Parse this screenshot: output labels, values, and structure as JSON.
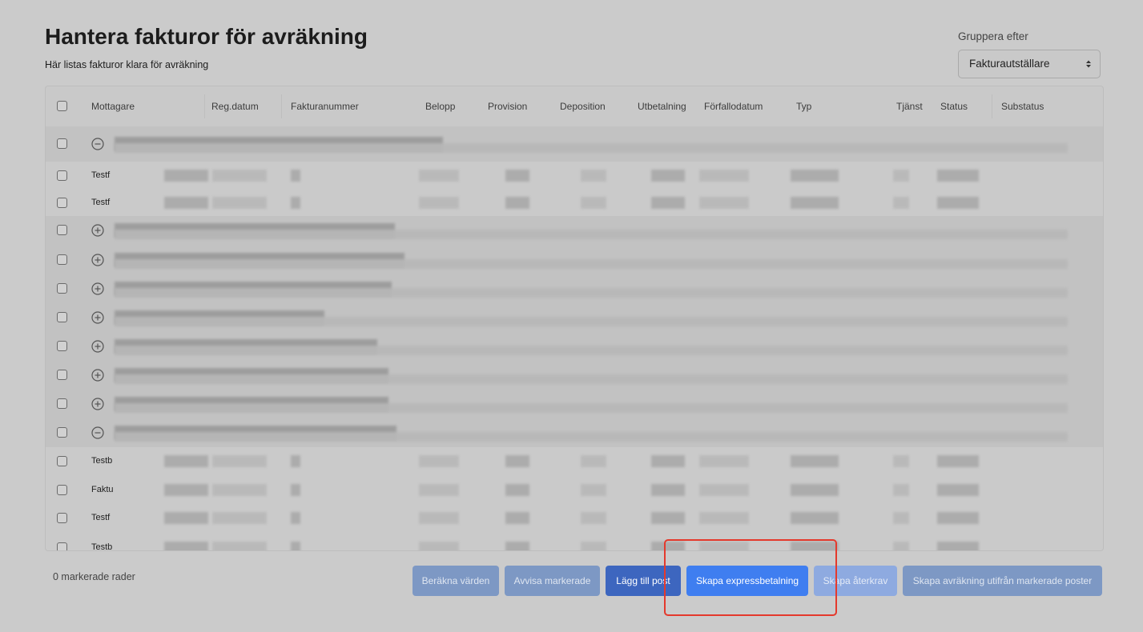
{
  "page": {
    "title": "Hantera fakturor för avräkning",
    "subtitle": "Här listas fakturor klara för avräkning"
  },
  "group_by": {
    "label": "Gruppera efter",
    "value": "Fakturautställare"
  },
  "table": {
    "columns": [
      "Mottagare",
      "Reg.datum",
      "Fakturanummer",
      "Belopp",
      "Provision",
      "Deposition",
      "Utbetalning",
      "Förfallodatum",
      "Typ",
      "Tjänst",
      "Status",
      "Substatus"
    ],
    "rows": [
      {
        "kind": "group",
        "state": "expanded"
      },
      {
        "kind": "item",
        "mottagare": "Testf"
      },
      {
        "kind": "item",
        "mottagare": "Testf"
      },
      {
        "kind": "group",
        "state": "collapsed"
      },
      {
        "kind": "group",
        "state": "collapsed"
      },
      {
        "kind": "group",
        "state": "collapsed"
      },
      {
        "kind": "group",
        "state": "collapsed"
      },
      {
        "kind": "group",
        "state": "collapsed"
      },
      {
        "kind": "group",
        "state": "collapsed"
      },
      {
        "kind": "group",
        "state": "collapsed"
      },
      {
        "kind": "group",
        "state": "expanded"
      },
      {
        "kind": "item",
        "mottagare": "Testb"
      },
      {
        "kind": "item",
        "mottagare": "Faktu"
      },
      {
        "kind": "item",
        "mottagare": "Testf"
      },
      {
        "kind": "item",
        "mottagare": "Testb"
      }
    ]
  },
  "footer": {
    "selected_count": "0 markerade rader",
    "buttons": {
      "calculate": "Beräkna värden",
      "reject": "Avvisa markerade",
      "add_post": "Lägg till post",
      "express": "Skapa expressbetalning",
      "claim": "Skapa återkrav",
      "settlement": "Skapa avräkning utifrån markerade poster"
    }
  },
  "colors": {
    "highlight": "#e4392c",
    "primary": "#3f7ef0",
    "primary_dark": "#3d66bf",
    "disabled": "#7d98c4"
  }
}
